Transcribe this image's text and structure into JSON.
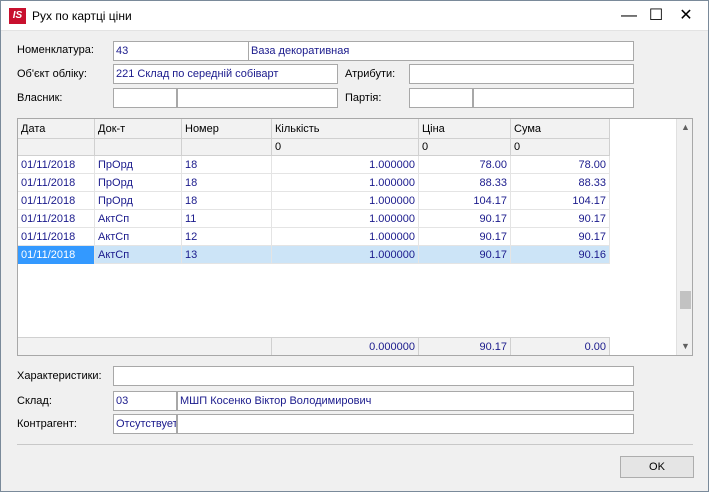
{
  "window": {
    "logo_text": "IS",
    "title": "Рух по картці ціни",
    "minimize": "—",
    "maximize": "☐",
    "close": "✕"
  },
  "form": {
    "nomenclature_label": "Номенклатура:",
    "nomenclature_code": "43",
    "nomenclature_name": "Ваза декоративная",
    "account_object_label": "Об'єкт обліку:",
    "account_object_value": "221 Склад по середній собіварт",
    "attributes_label": "Атрибути:",
    "attributes_value": "",
    "owner_label": "Власник:",
    "owner_code": "",
    "owner_name": "",
    "batch_label": "Партія:",
    "batch_code": "",
    "batch_name": ""
  },
  "table": {
    "columns": [
      "Дата",
      "Док-т",
      "Номер",
      "Кількість",
      "Ціна",
      "Сума"
    ],
    "filter": [
      "",
      "",
      "",
      "0",
      "0",
      "0"
    ],
    "rows": [
      {
        "date": "01/11/2018",
        "doc": "ПрОрд",
        "number": "18",
        "qty": "1.000000",
        "price": "78.00",
        "sum": "78.00"
      },
      {
        "date": "01/11/2018",
        "doc": "ПрОрд",
        "number": "18",
        "qty": "1.000000",
        "price": "88.33",
        "sum": "88.33"
      },
      {
        "date": "01/11/2018",
        "doc": "ПрОрд",
        "number": "18",
        "qty": "1.000000",
        "price": "104.17",
        "sum": "104.17"
      },
      {
        "date": "01/11/2018",
        "doc": "АктСп",
        "number": "11",
        "qty": "1.000000",
        "price": "90.17",
        "sum": "90.17"
      },
      {
        "date": "01/11/2018",
        "doc": "АктСп",
        "number": "12",
        "qty": "1.000000",
        "price": "90.17",
        "sum": "90.17"
      },
      {
        "date": "01/11/2018",
        "doc": "АктСп",
        "number": "13",
        "qty": "1.000000",
        "price": "90.17",
        "sum": "90.16"
      }
    ],
    "selected_row": 5,
    "footer": {
      "qty": "0.000000",
      "price": "90.17",
      "sum": "0.00"
    },
    "scroll_up": "▲",
    "scroll_down": "▼"
  },
  "bottom": {
    "characteristics_label": "Характеристики:",
    "characteristics_value": "",
    "warehouse_label": "Склад:",
    "warehouse_code": "03",
    "warehouse_name": "МШП Косенко Віктор Володимирович",
    "counterparty_label": "Контрагент:",
    "counterparty_code": "Отсутствует",
    "counterparty_name": ""
  },
  "buttons": {
    "ok": "OK"
  }
}
